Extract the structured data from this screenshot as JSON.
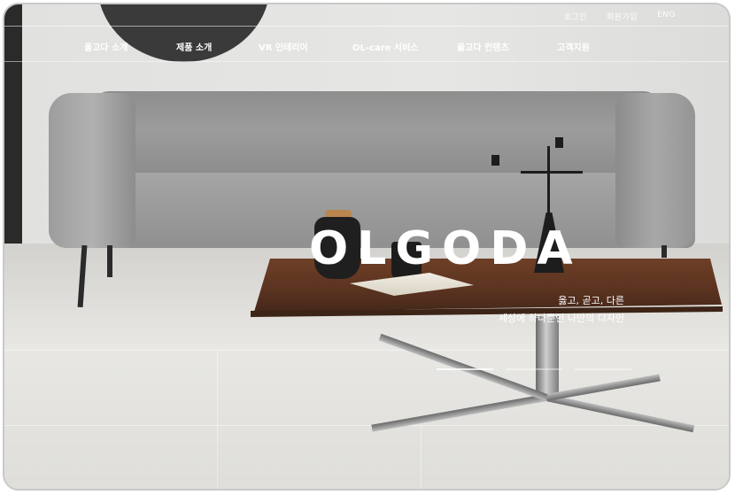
{
  "utility_nav": [
    "로그인",
    "회원가입",
    "ENG"
  ],
  "main_nav": [
    "올고다 소개",
    "제품 소개",
    "VR 인테리어",
    "OL-care 서비스",
    "올고다 컨텐츠",
    "고객지원"
  ],
  "hero": {
    "brand": "OLGODA",
    "tagline_line1": "옳고, 곧고, 다른",
    "tagline_line2": "세상에 하나뿐인 나만의 디자인"
  },
  "slider": {
    "slide_count": 3,
    "active_index": 0
  },
  "colors": {
    "nav_text": "#ffffff",
    "brand_text": "#ffffff",
    "deco_circle": "#3a3a3a"
  }
}
